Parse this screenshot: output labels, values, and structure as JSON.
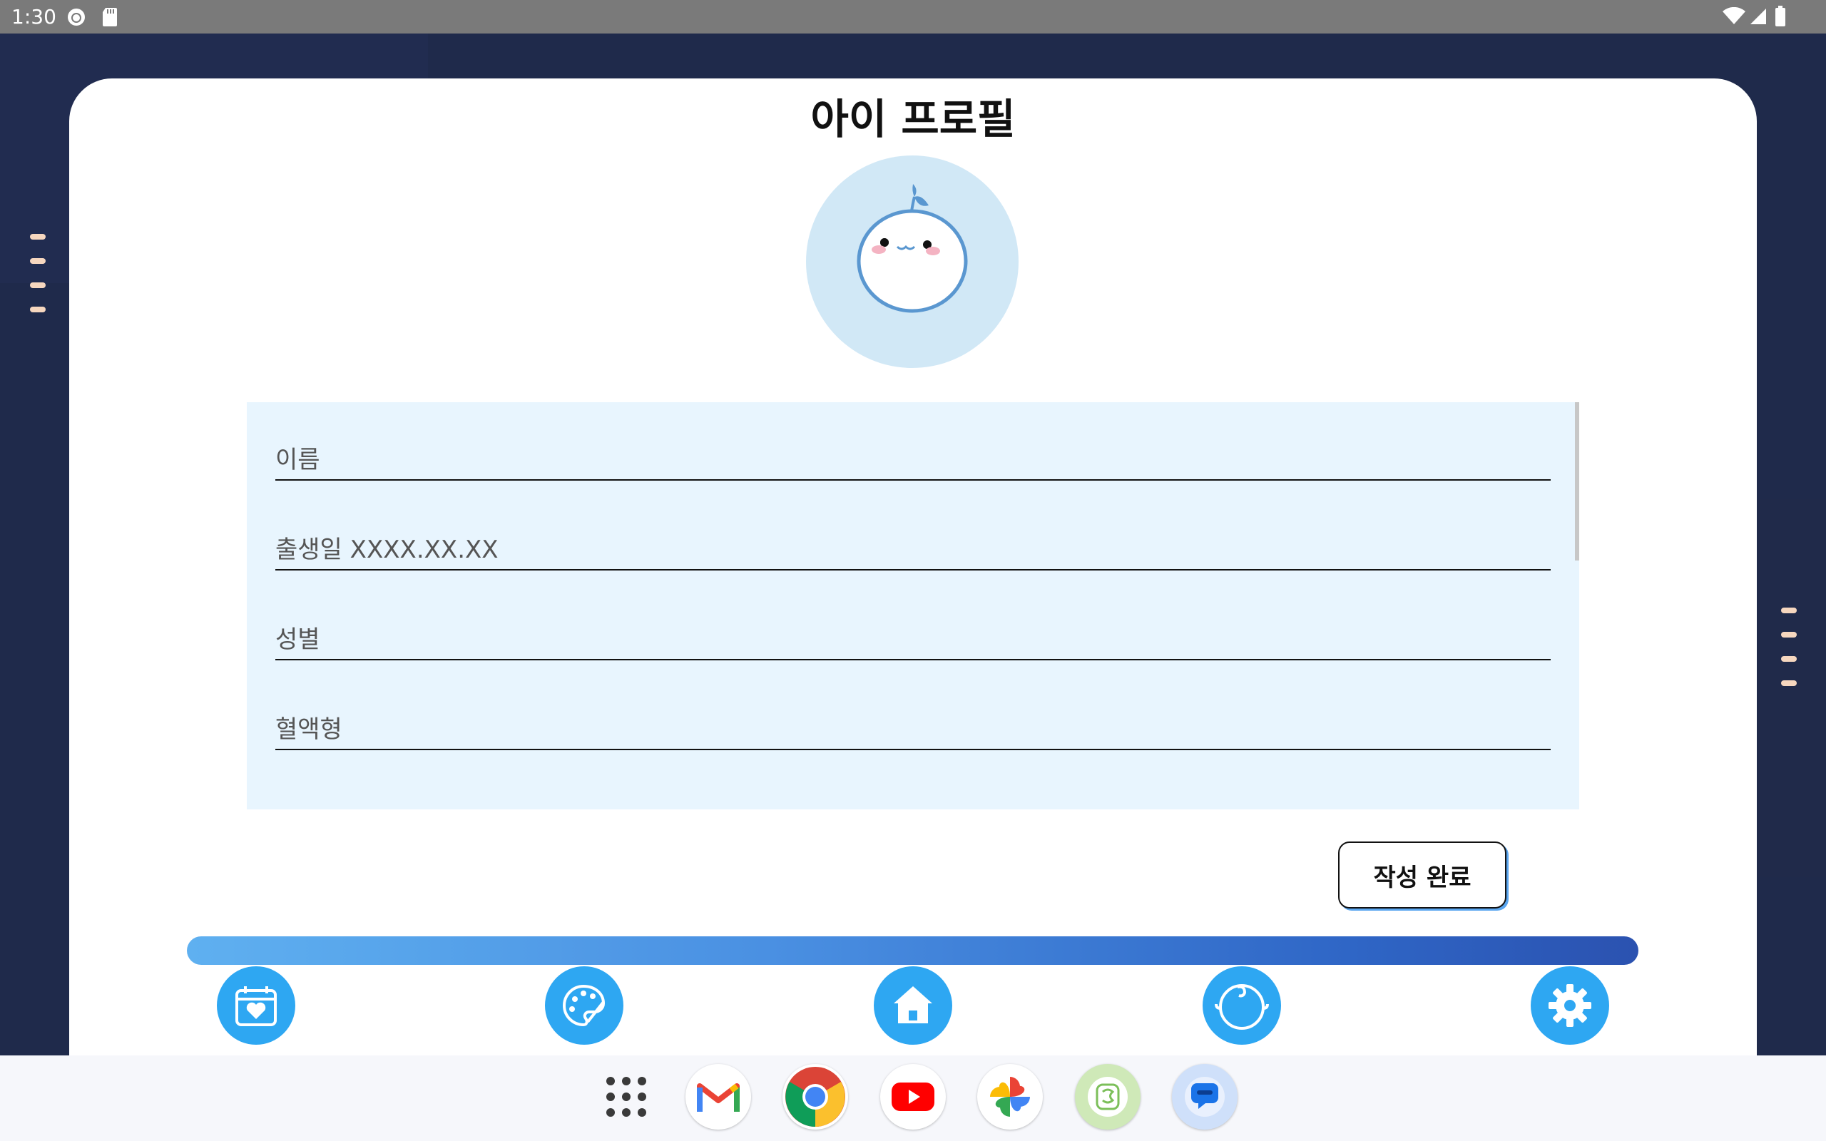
{
  "status_bar": {
    "time": "1:30"
  },
  "page": {
    "title": "아이 프로필"
  },
  "form": {
    "fields": [
      {
        "placeholder": "이름"
      },
      {
        "placeholder": "출생일 XXXX.XX.XX"
      },
      {
        "placeholder": "성별"
      },
      {
        "placeholder": "혈액형"
      }
    ]
  },
  "actions": {
    "submit_label": "작성 완료"
  },
  "colors": {
    "background": "#1f2a4b",
    "accent": "#2ea7f2",
    "form_bg": "#e8f5fe",
    "avatar_bg": "#d1e8f6"
  },
  "bottom_nav": {
    "items": [
      {
        "icon": "calendar-heart-icon"
      },
      {
        "icon": "palette-icon"
      },
      {
        "icon": "home-icon"
      },
      {
        "icon": "baby-face-icon"
      },
      {
        "icon": "gear-icon"
      }
    ]
  },
  "dock": {
    "apps": [
      {
        "icon": "app-grid-icon"
      },
      {
        "icon": "gmail-icon"
      },
      {
        "icon": "chrome-icon"
      },
      {
        "icon": "youtube-icon"
      },
      {
        "icon": "photos-icon"
      },
      {
        "icon": "app-icon"
      },
      {
        "icon": "messages-icon"
      }
    ]
  }
}
